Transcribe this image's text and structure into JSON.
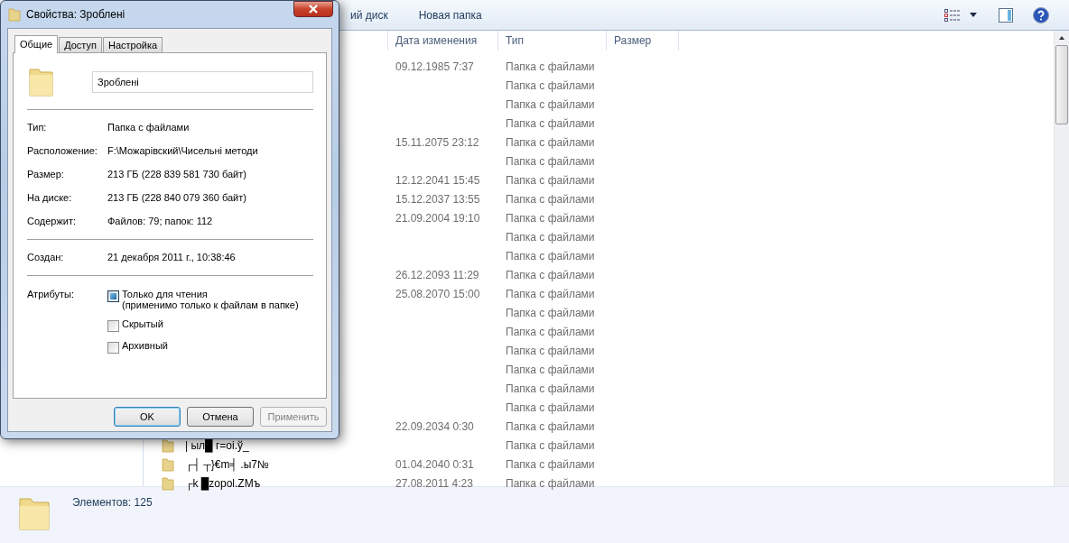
{
  "toolbar": {
    "items": [
      "ий диск",
      "Новая папка"
    ]
  },
  "table": {
    "columns": [
      "Дата изменения",
      "Тип",
      "Размер"
    ],
    "rows": [
      {
        "date": "09.12.1985 7:37",
        "type": "Папка с файлами"
      },
      {
        "type": "Папка с файлами"
      },
      {
        "type": "Папка с файлами"
      },
      {
        "type": "Папка с файлами"
      },
      {
        "date": "15.11.2075 23:12",
        "type": "Папка с файлами"
      },
      {
        "type": "Папка с файлами"
      },
      {
        "date": "12.12.2041 15:45",
        "type": "Папка с файлами"
      },
      {
        "date": "15.12.2037 13:55",
        "type": "Папка с файлами"
      },
      {
        "date": "21.09.2004 19:10",
        "type": "Папка с файлами"
      },
      {
        "type": "Папка с файлами"
      },
      {
        "type": "Папка с файлами"
      },
      {
        "date": "26.12.2093 11:29",
        "type": "Папка с файлами"
      },
      {
        "date": "25.08.2070 15:00",
        "type": "Папка с файлами"
      },
      {
        "type": "Папка с файлами"
      },
      {
        "type": "Папка с файлами"
      },
      {
        "type": "Папка с файлами"
      },
      {
        "type": "Папка с файлами"
      },
      {
        "type": "Папка с файлами"
      },
      {
        "type": "Папка с файлами"
      },
      {
        "date": "22.09.2034 0:30",
        "type": "Папка с файлами"
      },
      {
        "name": "| ыл█ г=оі.ў_",
        "type": "Папка с файлами"
      },
      {
        "name": "┌┤ ┬}€m╡ .ы7№",
        "date": "01.04.2040 0:31",
        "type": "Папка с файлами"
      },
      {
        "name": "┌k █zopol.ZMъ",
        "date": "27.08.2011 4:23",
        "type": "Папка с файлами"
      }
    ]
  },
  "status_bar": {
    "text": "Элементов: 125"
  },
  "dialog": {
    "title": "Свойства: Зроблені",
    "tabs": [
      {
        "label": "Общие",
        "selected": true
      },
      {
        "label": "Доступ",
        "selected": false
      },
      {
        "label": "Настройка",
        "selected": false
      }
    ],
    "name_field": {
      "value": "Зроблені"
    },
    "groups": [
      [
        {
          "label": "Тип:",
          "value": "Папка с файлами"
        },
        {
          "label": "Расположение:",
          "value": "F:\\Можарівский\\Чисельні методи"
        },
        {
          "label": "Размер:",
          "value": "213 ГБ (228 839 581 730 байт)"
        },
        {
          "label": "На диске:",
          "value": "213 ГБ (228 840 079 360 байт)"
        },
        {
          "label": "Содержит:",
          "value": "Файлов: 79; папок: 112"
        }
      ],
      [
        {
          "label": "Создан:",
          "value": "21 декабря 2011 г., 10:38:46"
        }
      ]
    ],
    "attributes_label": "Атрибуты:",
    "attributes": [
      {
        "label": "Только для чтения",
        "note": "(применимо только к файлам в папке)",
        "checked": true
      },
      {
        "label": "Скрытый",
        "checked": false
      },
      {
        "label": "Архивный",
        "checked": false
      }
    ],
    "buttons": [
      {
        "label": "OK",
        "disabled": false
      },
      {
        "label": "Отмена",
        "disabled": false
      },
      {
        "label": "Применить",
        "disabled": true
      }
    ]
  }
}
